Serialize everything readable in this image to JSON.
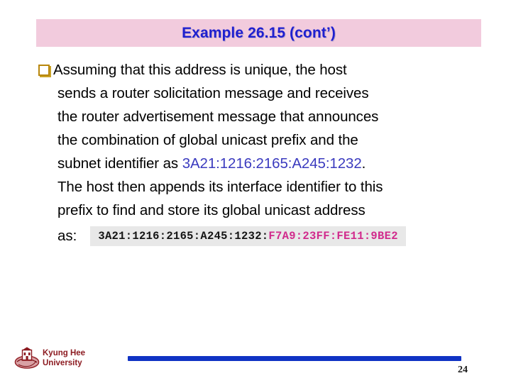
{
  "slide": {
    "title": "Example 26.15 (cont’)",
    "title_color": "#1f20cf",
    "title_band_color": "#f2cbdd",
    "bullet_icon": "hollow-square-bullet",
    "body": {
      "line1_text": "Assuming that this address is unique, the host",
      "line2": "sends a router solicitation message and receives",
      "line3": "the router advertisement message that announces",
      "line4": "the combination of global unicast prefix and the",
      "line5_prefix": "subnet identifier as ",
      "line5_address": "3A21:1216:2165:A245:1232",
      "line5_suffix": ".",
      "line6": "The host then appends its interface identifier to this",
      "line7": "prefix to find and store its global unicast address",
      "line8_label": "as:"
    },
    "address_box": {
      "prefix": "3A21:1216:2165:A245:1232:",
      "interface_identifier": "F7A9:23FF:FE11:9BE2",
      "background_color": "#e8e8e8",
      "prefix_color": "#141414",
      "identifier_color": "#d12a8c"
    },
    "inline_address_color": "#3b3bbf",
    "footer": {
      "logo_name": "kyung-hee-university-emblem",
      "organization_line1": "Kyung Hee",
      "organization_line2": "University",
      "logo_color": "#8c1b21",
      "rule_color": "#1033c4",
      "page_number": "24"
    }
  }
}
